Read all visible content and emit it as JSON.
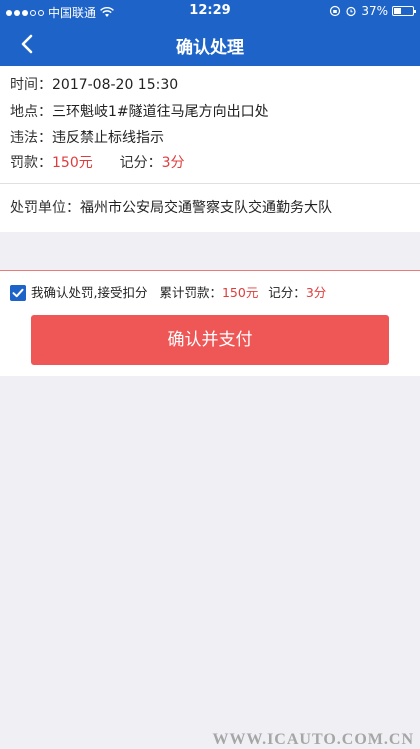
{
  "status_bar": {
    "carrier": "中国联通",
    "time": "12:29",
    "battery": "37%",
    "battery_level": 0.37
  },
  "nav": {
    "title": "确认处理"
  },
  "violation": {
    "time_label": "时间：",
    "time_value": "2017-08-20 15:30",
    "place_label": "地点：",
    "place_value": "三环魁岐1#隧道往马尾方向出口处",
    "offense_label": "违法：",
    "offense_value": "违反禁止标线指示",
    "fine_label": "罚款：",
    "fine_value": "150元",
    "points_label": "记分：",
    "points_value": "3分"
  },
  "unit": {
    "label": "处罚单位：",
    "value": "福州市公安局交通警察支队交通勤务大队"
  },
  "confirm": {
    "checked": true,
    "text": "我确认处罚,接受扣分",
    "total_fine_label": "累计罚款：",
    "total_fine_value": "150元",
    "total_points_label": "记分：",
    "total_points_value": "3分",
    "button_label": "确认并支付"
  },
  "watermark": "WWW.ICAUTO.COM.CN",
  "colors": {
    "brand_blue": "#1e64c8",
    "accent_red": "#e03c3c",
    "button_red": "#ef5656"
  }
}
